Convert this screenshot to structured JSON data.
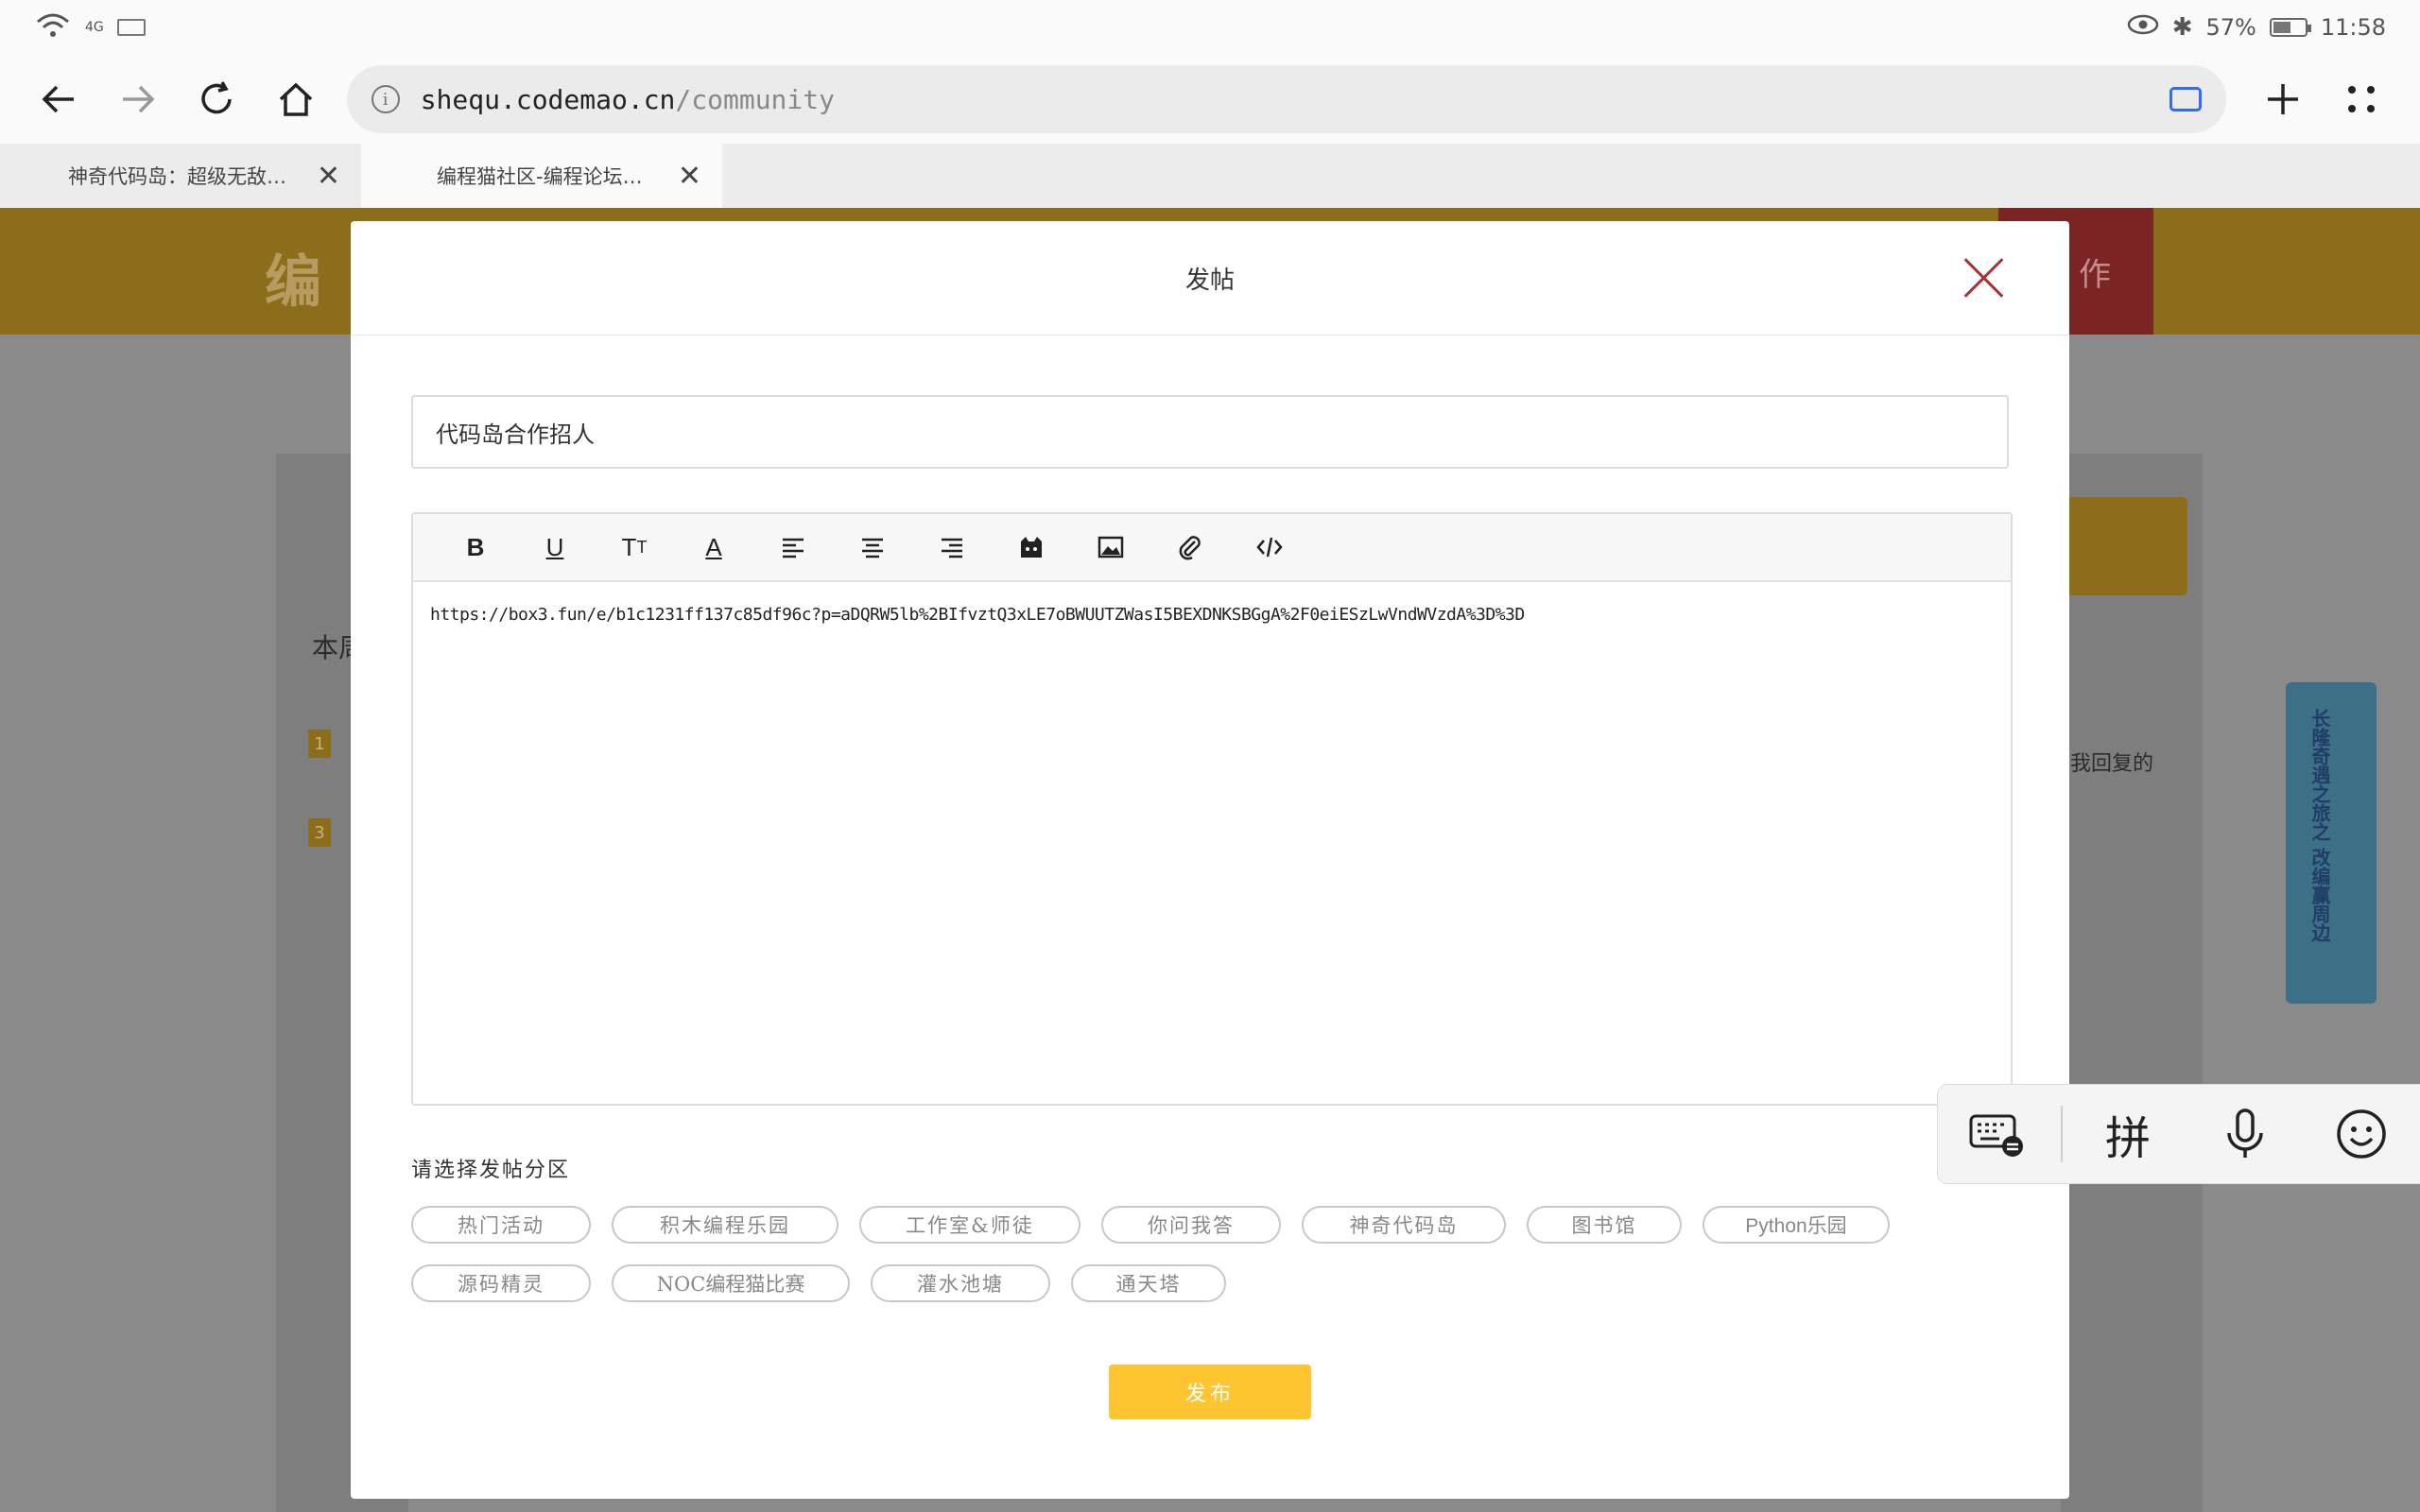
{
  "status_bar": {
    "signal": "4G",
    "battery_percent": "57%",
    "battery_level": 0.57,
    "time": "11:58"
  },
  "browser": {
    "url_host": "shequ.codemao.cn",
    "url_path": "/community",
    "tabs": [
      {
        "label": "神奇代码岛：超级无敌…",
        "active": false
      },
      {
        "label": "编程猫社区-编程论坛…",
        "active": true
      }
    ]
  },
  "background_page": {
    "logo": "编",
    "header_button": "作",
    "left_text": "本周",
    "rank_1": "1",
    "rank_3": "3",
    "right_text": "我回复的",
    "banner_text": "长隆奇遇之旅之 改编赢周边"
  },
  "modal": {
    "title": "发帖",
    "title_input_value": "代码岛合作招人",
    "editor_content": "https://box3.fun/e/b1c1231ff137c85df96c?p=aDQRW5lb%2BIfvztQ3xLE7oBWUUTZWasI5BEXDNKSBGgA%2F0eiESzLwVndWVzdA%3D%3D",
    "section_label": "请选择发帖分区",
    "categories_row1": [
      "热门活动",
      "积木编程乐园",
      "工作室&师徒",
      "你问我答",
      "神奇代码岛",
      "图书馆",
      "Python乐园"
    ],
    "categories_row2": [
      "源码精灵",
      "NOC编程猫比赛",
      "灌水池塘",
      "通天塔"
    ],
    "publish_label": "发布"
  },
  "ime": {
    "pinyin_label": "拼"
  }
}
